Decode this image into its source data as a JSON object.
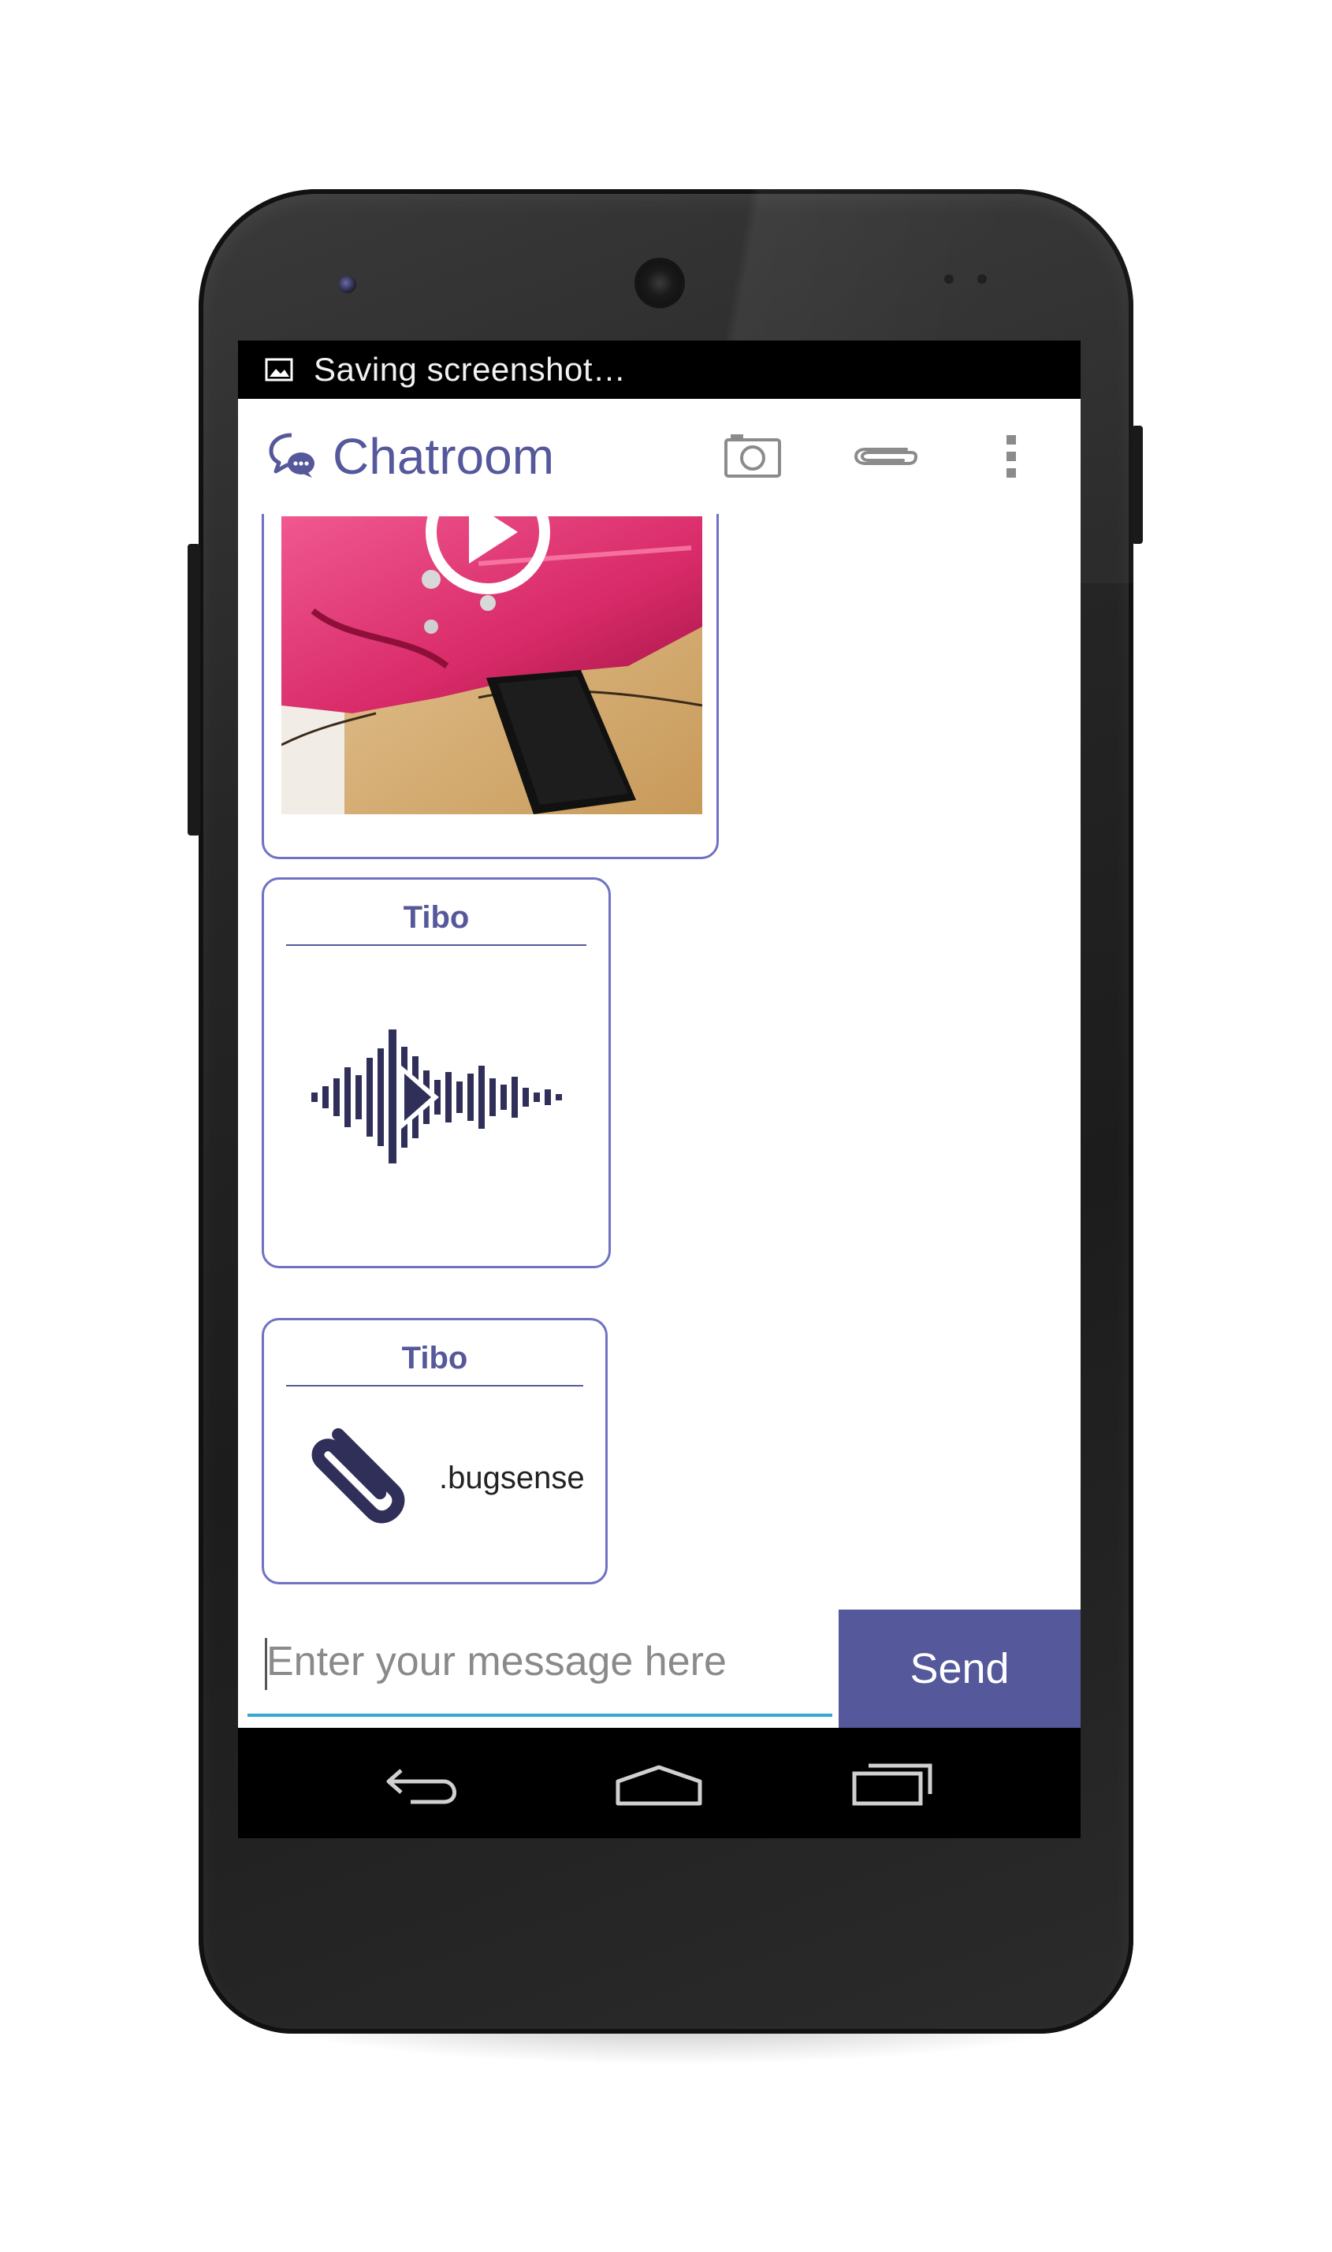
{
  "status_bar": {
    "notification_text": "Saving screenshot…",
    "icon": "image-icon"
  },
  "action_bar": {
    "title": "Chatroom",
    "app_icon": "chat-bubbles-icon",
    "actions": [
      {
        "name": "camera",
        "icon": "camera-icon"
      },
      {
        "name": "attach",
        "icon": "paperclip-icon"
      },
      {
        "name": "overflow",
        "icon": "overflow-menu-icon"
      }
    ]
  },
  "messages": [
    {
      "type": "video",
      "icon": "play-icon"
    },
    {
      "type": "audio",
      "sender": "Tibo",
      "icon": "audio-waveform-play-icon"
    },
    {
      "type": "file",
      "sender": "Tibo",
      "filename": ".bugsense",
      "icon": "paperclip-icon"
    }
  ],
  "composer": {
    "placeholder": "Enter your message here",
    "value": "",
    "send_label": "Send"
  },
  "nav_bar": {
    "buttons": [
      "back",
      "home",
      "recents"
    ]
  },
  "colors": {
    "accent": "#55589a",
    "bubble_border": "#6f72c4",
    "input_underline": "#33a6d4"
  }
}
